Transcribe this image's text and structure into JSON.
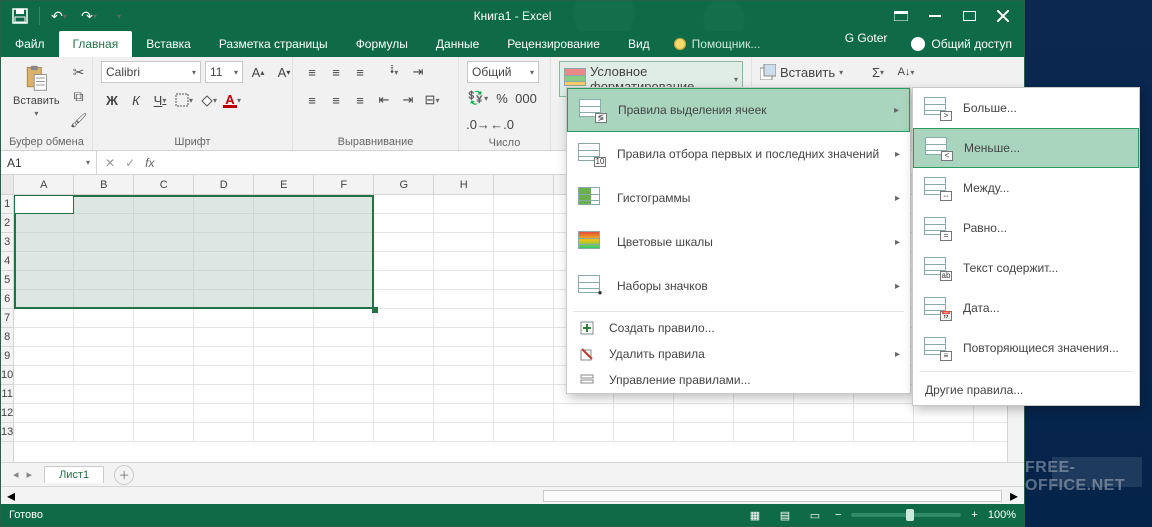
{
  "title": "Книга1 - Excel",
  "qat": {
    "save": "💾",
    "undo": "↶",
    "redo": "↷"
  },
  "window": {
    "user": "G Goter",
    "share": "Общий доступ",
    "tell": "Помощник..."
  },
  "tabs": {
    "file": "Файл",
    "home": "Главная",
    "insert": "Вставка",
    "layout": "Разметка страницы",
    "formulas": "Формулы",
    "data": "Данные",
    "review": "Рецензирование",
    "view": "Вид"
  },
  "ribbon": {
    "clipboard": {
      "paste": "Вставить",
      "label": "Буфер обмена"
    },
    "font": {
      "name": "Calibri",
      "size": "11",
      "label": "Шрифт"
    },
    "align": {
      "label": "Выравнивание"
    },
    "number": {
      "format": "Общий",
      "label": "Число"
    },
    "cond": "Условное форматирование",
    "insert_btn": "Вставить"
  },
  "namebox": "A1",
  "columns": [
    "A",
    "B",
    "C",
    "D",
    "E",
    "F",
    "G",
    "H"
  ],
  "rows": [
    "1",
    "2",
    "3",
    "4",
    "5",
    "6",
    "7",
    "8",
    "9",
    "10",
    "11",
    "12",
    "13"
  ],
  "sheet": "Лист1",
  "status": {
    "ready": "Готово",
    "zoom": "100%"
  },
  "menu1": {
    "highlight": "Правила выделения ячеек",
    "toprules": "Правила отбора первых и последних значений",
    "databars": "Гистограммы",
    "colorscales": "Цветовые шкалы",
    "iconsets": "Наборы значков",
    "newrule": "Создать правило...",
    "clear": "Удалить правила",
    "manage": "Управление правилами..."
  },
  "menu2": {
    "greater": "Больше...",
    "less": "Меньше...",
    "between": "Между...",
    "equal": "Равно...",
    "textcontains": "Текст содержит...",
    "date": "Дата...",
    "duplicate": "Повторяющиеся значения...",
    "other": "Другие правила..."
  },
  "watermark": "FREE-OFFICE.NET"
}
